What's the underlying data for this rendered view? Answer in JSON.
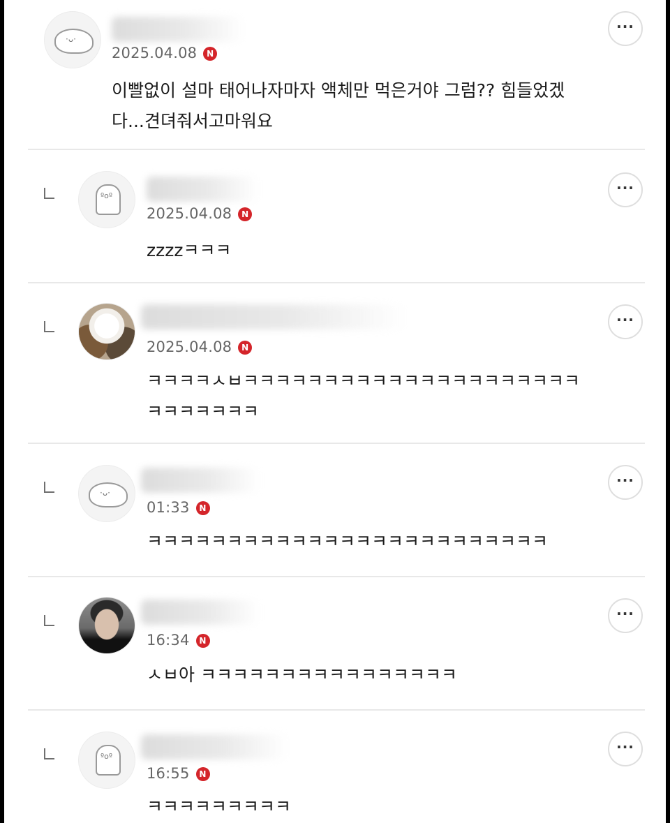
{
  "comments": [
    {
      "date": "2025.04.08",
      "badge": "N",
      "text_lines": [
        "이빨없이 설마 태어나자마자 액체만 먹은거야 그럼?? 힘들었겠",
        "다...견뎌줘서고마워요"
      ],
      "avatar": "dinosaur-icon",
      "is_reply": false
    },
    {
      "date": "2025.04.08",
      "badge": "N",
      "text_lines": [
        "zzzzㅋㅋㅋ"
      ],
      "avatar": "ghost-character-icon",
      "is_reply": true
    },
    {
      "date": "2025.04.08",
      "badge": "N",
      "text_lines": [
        "ㅋㅋㅋㅋㅅㅂㅋㅋㅋㅋㅋㅋㅋㅋㅋㅋㅋㅋㅋㅋㅋㅋㅋㅋㅋㅋㅋ",
        "ㅋㅋㅋㅋㅋㅋㅋ"
      ],
      "avatar": "dog-photo",
      "is_reply": true
    },
    {
      "date": "01:33",
      "badge": "N",
      "text_lines": [
        "ㅋㅋㅋㅋㅋㅋㅋㅋㅋㅋㅋㅋㅋㅋㅋㅋㅋㅋㅋㅋㅋㅋㅋㅋㅋ"
      ],
      "avatar": "dinosaur-icon",
      "is_reply": true
    },
    {
      "date": "16:34",
      "badge": "N",
      "text_lines": [
        "ㅅㅂ아 ㅋㅋㅋㅋㅋㅋㅋㅋㅋㅋㅋㅋㅋㅋㅋㅋ"
      ],
      "avatar": "person-photo",
      "is_reply": true
    },
    {
      "date": "16:55",
      "badge": "N",
      "text_lines": [
        "ㅋㅋㅋㅋㅋㅋㅋㅋㅋ"
      ],
      "avatar": "ghost-character-icon",
      "is_reply": true
    }
  ],
  "more_button_label": "···",
  "colors": {
    "badge": "#d4252a",
    "divider": "#e8e8e8",
    "date": "#666666"
  }
}
